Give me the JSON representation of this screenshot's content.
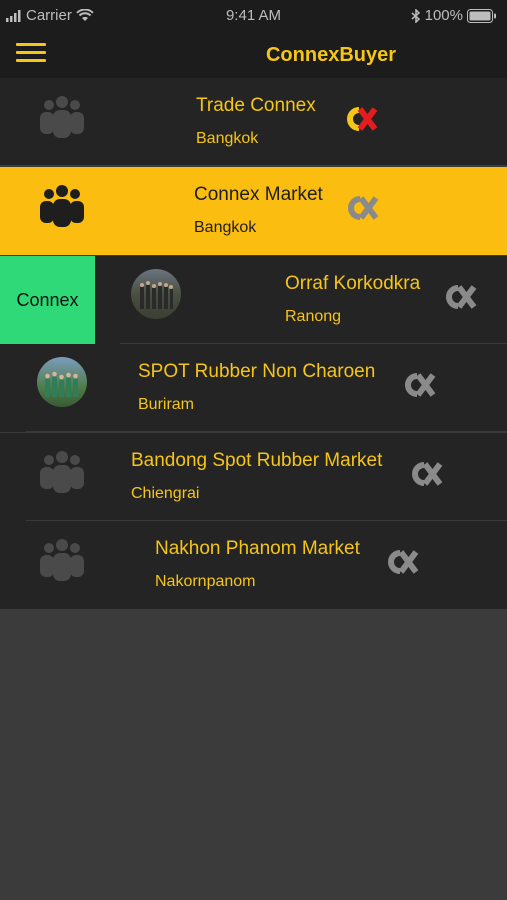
{
  "status_bar": {
    "carrier": "Carrier",
    "time": "9:41 AM",
    "battery": "100%"
  },
  "nav": {
    "title": "ConnexBuyer"
  },
  "swipe_action": {
    "label": "Connex"
  },
  "markets": [
    {
      "name": "Trade Connex",
      "location": "Bangkok"
    },
    {
      "name": "Connex Market",
      "location": "Bangkok"
    },
    {
      "name": "Orraf Korkodkra",
      "location": "Ranong"
    },
    {
      "name": "SPOT Rubber Non Charoen",
      "location": "Buriram"
    },
    {
      "name": "Bandong Spot Rubber Market",
      "location": "Chiengrai"
    },
    {
      "name": "Nakhon Phanom Market",
      "location": "Nakornpanom"
    }
  ],
  "colors": {
    "accent": "#f5c518",
    "selected_row": "#fbbd0f",
    "swipe_action": "#2fd978",
    "row_bg": "#242424"
  }
}
